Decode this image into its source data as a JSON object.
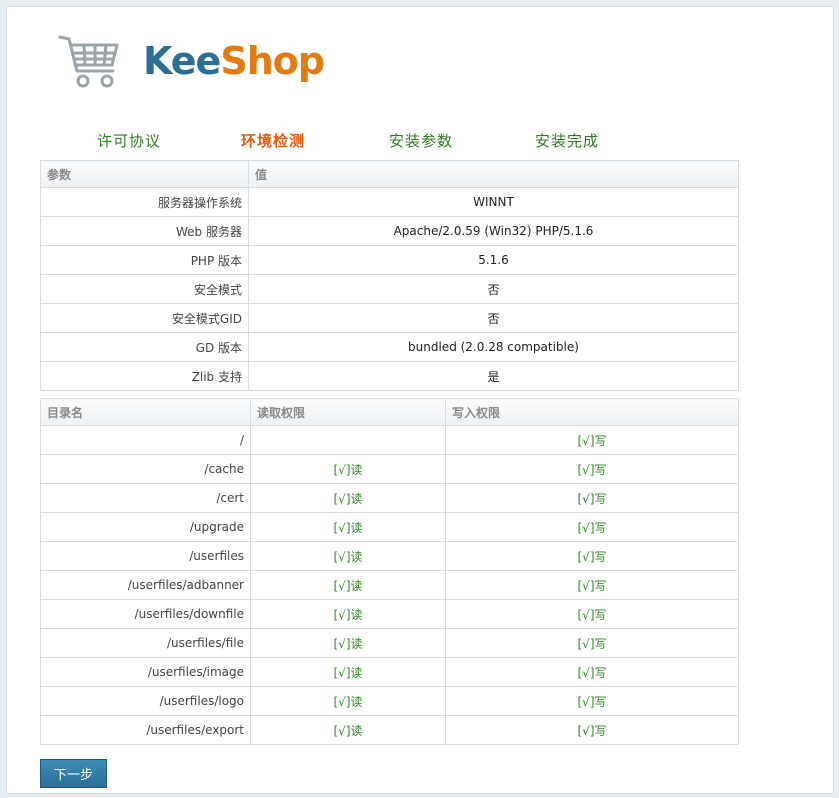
{
  "brand": {
    "kee": "Kee",
    "shop": "Shop"
  },
  "steps": [
    {
      "label": "许可协议",
      "active": false
    },
    {
      "label": "环境检测",
      "active": true
    },
    {
      "label": "安装参数",
      "active": false
    },
    {
      "label": "安装完成",
      "active": false
    }
  ],
  "env_table": {
    "headers": [
      "参数",
      "值"
    ],
    "rows": [
      {
        "param": "服务器操作系统",
        "value": "WINNT"
      },
      {
        "param": "Web 服务器",
        "value": "Apache/2.0.59 (Win32) PHP/5.1.6"
      },
      {
        "param": "PHP 版本",
        "value": "5.1.6"
      },
      {
        "param": "安全模式",
        "value": "否"
      },
      {
        "param": "安全模式GID",
        "value": "否"
      },
      {
        "param": "GD 版本",
        "value": "bundled (2.0.28 compatible)"
      },
      {
        "param": "Zlib 支持",
        "value": "是"
      }
    ]
  },
  "dir_table": {
    "headers": [
      "目录名",
      "读取权限",
      "写入权限"
    ],
    "rows": [
      {
        "dir": "/",
        "read": "",
        "write": "[√]写"
      },
      {
        "dir": "/cache",
        "read": "[√]读",
        "write": "[√]写"
      },
      {
        "dir": "/cert",
        "read": "[√]读",
        "write": "[√]写"
      },
      {
        "dir": "/upgrade",
        "read": "[√]读",
        "write": "[√]写"
      },
      {
        "dir": "/userfiles",
        "read": "[√]读",
        "write": "[√]写"
      },
      {
        "dir": "/userfiles/adbanner",
        "read": "[√]读",
        "write": "[√]写"
      },
      {
        "dir": "/userfiles/downfile",
        "read": "[√]读",
        "write": "[√]写"
      },
      {
        "dir": "/userfiles/file",
        "read": "[√]读",
        "write": "[√]写"
      },
      {
        "dir": "/userfiles/image",
        "read": "[√]读",
        "write": "[√]写"
      },
      {
        "dir": "/userfiles/logo",
        "read": "[√]读",
        "write": "[√]写"
      },
      {
        "dir": "/userfiles/export",
        "read": "[√]读",
        "write": "[√]写"
      }
    ]
  },
  "next_button": "下一步"
}
